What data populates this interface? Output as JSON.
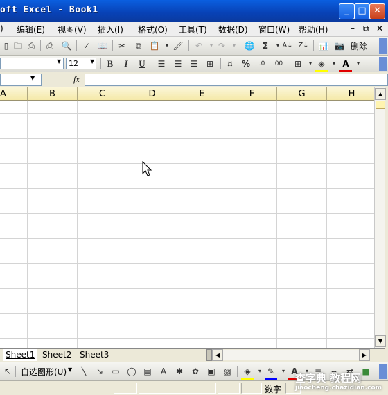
{
  "window": {
    "title": "oft Excel - Book1"
  },
  "menus": [
    "编辑(E)",
    "视图(V)",
    "插入(I)",
    "格式(O)",
    "工具(T)",
    "数据(D)",
    "窗口(W)",
    "帮助(H)"
  ],
  "menu_left_fragment": ")",
  "toolbar": {
    "delete_label": "删除",
    "sigma": "Σ"
  },
  "format": {
    "font_size": "12",
    "bold": "B",
    "italic": "I",
    "underline": "U",
    "percent": "%"
  },
  "formula": {
    "fx": "fx"
  },
  "columns": [
    "A",
    "B",
    "C",
    "D",
    "E",
    "F",
    "G",
    "H"
  ],
  "sheets": [
    "Sheet1",
    "Sheet2",
    "Sheet3"
  ],
  "draw": {
    "autoshapes": "自选图形(U)"
  },
  "status": {
    "mode": "数字"
  },
  "watermark": {
    "line1": "查字典 教程网",
    "line2": "jiaocheng.chazidian.com"
  }
}
